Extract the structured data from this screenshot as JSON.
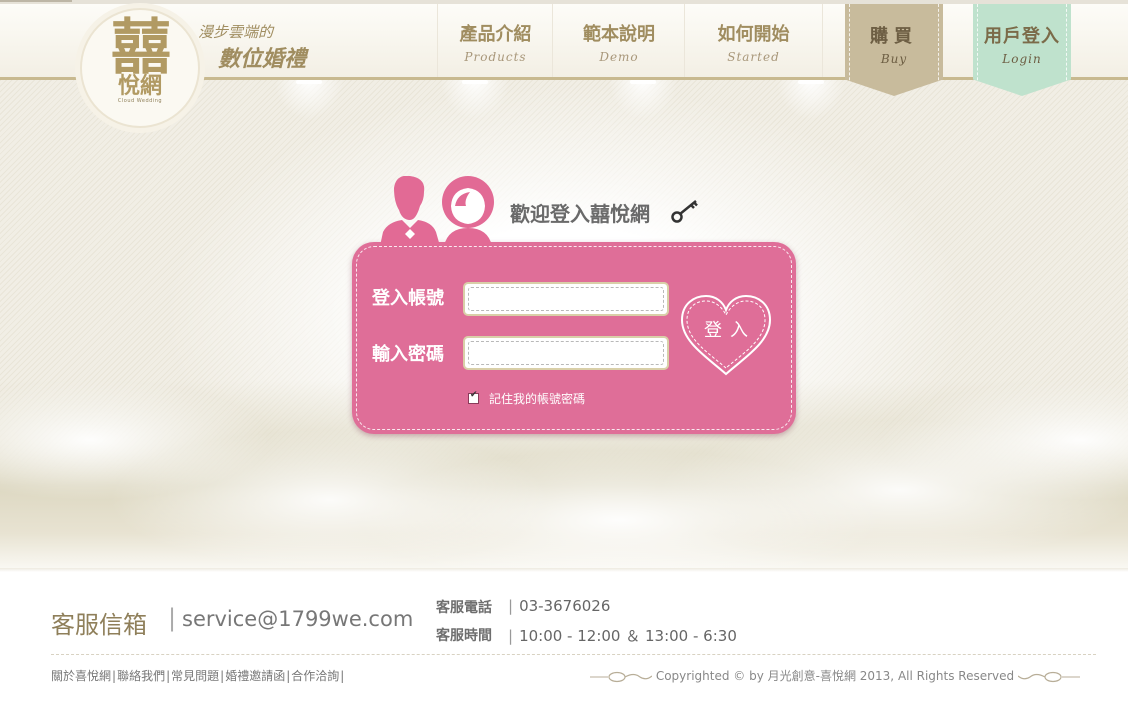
{
  "header": {
    "logo": {
      "main_char": "囍",
      "sub_text": "悅網",
      "tiny_text": "Cloud Wedding"
    },
    "slogan_line1": "漫步雲端的",
    "slogan_line2": "數位婚禮",
    "nav": [
      {
        "cn": "產品介紹",
        "en": "Products"
      },
      {
        "cn": "範本說明",
        "en": "Demo"
      },
      {
        "cn": "如何開始",
        "en": "Started"
      }
    ],
    "buy": {
      "cn": "購買",
      "en": "Buy",
      "color": "#c8bb9c"
    },
    "login": {
      "cn": "用戶登入",
      "en": "Login",
      "color": "#bfe2cd"
    }
  },
  "login": {
    "welcome": "歡迎登入囍悅網",
    "account_label": "登入帳號",
    "account_value": "",
    "password_label": "輸入密碼",
    "password_value": "",
    "remember_label": "記住我的帳號密碼",
    "remember_checked": true,
    "submit_label": "登入",
    "box_color": "#df6e98"
  },
  "footer": {
    "mail_label": "客服信箱",
    "mail": "service@1799we.com",
    "tel_label": "客服電話",
    "tel": "03-3676026",
    "hours_label": "客服時間",
    "hours": "10:00 - 12:00 ＆ 13:00 - 6:30",
    "links": [
      "關於喜悅網",
      "聯絡我們",
      "常見問題",
      "婚禮邀請函",
      "合作洽詢"
    ],
    "copyright": "Copyrighted © by 月光創意-喜悅網 2013, All Rights Reserved"
  }
}
